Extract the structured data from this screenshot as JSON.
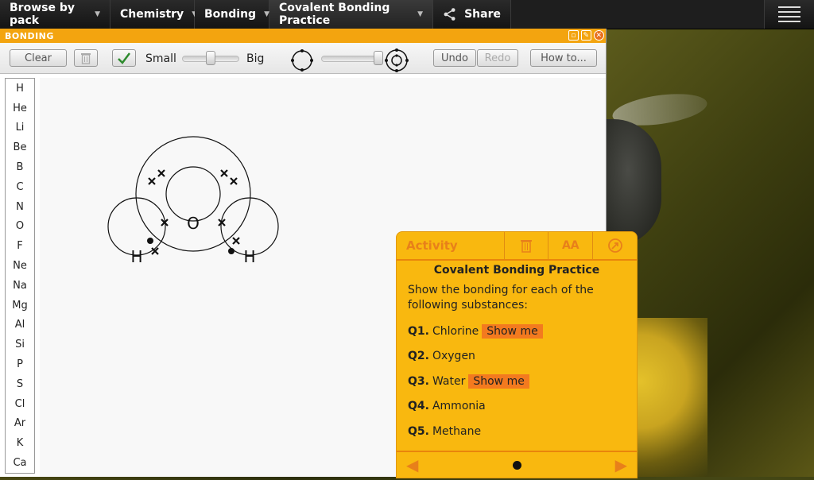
{
  "nav": {
    "items": [
      {
        "label": "Browse by pack"
      },
      {
        "label": "Chemistry"
      },
      {
        "label": "Bonding"
      },
      {
        "label": "Covalent Bonding Practice"
      }
    ],
    "share_label": "Share"
  },
  "window": {
    "title": "BONDING"
  },
  "toolbar": {
    "clear_label": "Clear",
    "small_label": "Small",
    "big_label": "Big",
    "undo_label": "Undo",
    "redo_label": "Redo",
    "howto_label": "How to..."
  },
  "elements": [
    "H",
    "He",
    "Li",
    "Be",
    "B",
    "C",
    "N",
    "O",
    "F",
    "Ne",
    "Na",
    "Mg",
    "Al",
    "Si",
    "P",
    "S",
    "Cl",
    "Ar",
    "K",
    "Ca"
  ],
  "diagram": {
    "center_atom": "O",
    "left_atom": "H",
    "right_atom": "H"
  },
  "activity": {
    "tab_label": "Activity",
    "font_icon_text": "AA",
    "title": "Covalent Bonding Practice",
    "description": "Show the bonding for each of the following substances:",
    "show_me_label": "Show me",
    "questions": [
      {
        "num": "Q1.",
        "text": "Chlorine",
        "has_show_me": true
      },
      {
        "num": "Q2.",
        "text": "Oxygen",
        "has_show_me": false
      },
      {
        "num": "Q3.",
        "text": "Water",
        "has_show_me": true
      },
      {
        "num": "Q4.",
        "text": "Ammonia",
        "has_show_me": false
      },
      {
        "num": "Q5.",
        "text": "Methane",
        "has_show_me": false
      }
    ]
  },
  "colors": {
    "accent_orange": "#f3a40f",
    "panel_yellow": "#f9b80f",
    "highlight_orange": "#f37a1f",
    "topbar_dark": "#1e1e1e"
  }
}
